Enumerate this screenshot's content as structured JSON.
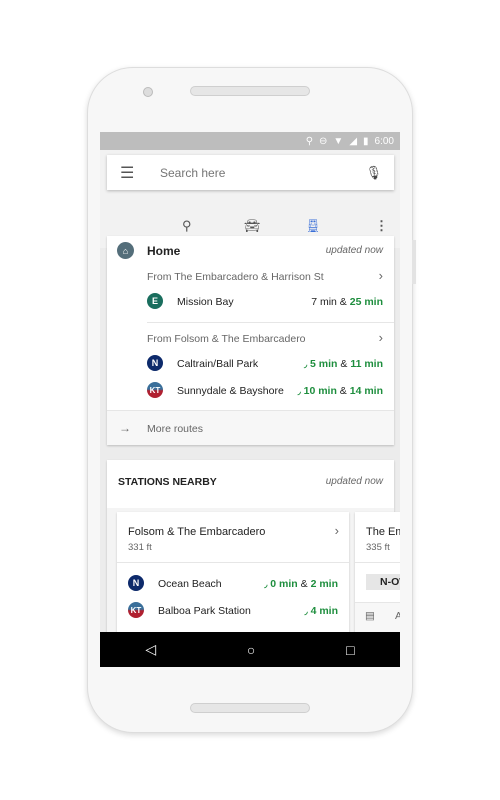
{
  "status_bar": {
    "time": "6:00",
    "icons": [
      "location-icon",
      "dnd-icon",
      "wifi-icon",
      "signal-icon",
      "battery-icon"
    ]
  },
  "search": {
    "placeholder": "Search here"
  },
  "tabs": [
    {
      "icon": "explore-icon"
    },
    {
      "icon": "car-icon"
    },
    {
      "icon": "transit-icon",
      "active": true
    },
    {
      "icon": "more-icon"
    }
  ],
  "home": {
    "title": "Home",
    "updated": "updated now",
    "groups": [
      {
        "from": "From The Embarcadero & Harrison St",
        "routes": [
          {
            "line": "E",
            "color": "#1a6e5e",
            "dest": "Mission Bay",
            "t1": "7 min",
            "t2": "25 min",
            "t1_live": false
          }
        ]
      },
      {
        "from": "From Folsom & The Embarcadero",
        "routes": [
          {
            "line": "N",
            "color": "#0d2a6b",
            "dest": "Caltrain/Ball Park",
            "t1": "5 min",
            "t2": "11 min",
            "t1_live": true
          },
          {
            "line": "KT",
            "color": "#b02030",
            "dest": "Sunnydale & Bayshore",
            "t1": "10 min",
            "t2": "14 min",
            "t1_live": true
          }
        ]
      }
    ],
    "more": "More routes",
    "amp": "&"
  },
  "stations": {
    "title": "STATIONS NEARBY",
    "updated": "updated now",
    "cards": [
      {
        "name": "Folsom & The Embarcadero",
        "dist": "331 ft",
        "routes": [
          {
            "line": "N",
            "color": "#0d2a6b",
            "dest": "Ocean Beach",
            "t1": "0 min",
            "t2": "2 min"
          },
          {
            "line": "KT",
            "color": "#b02030",
            "dest": "Balboa Park Station",
            "t1": "4 min"
          }
        ]
      },
      {
        "name": "The Em",
        "dist": "335 ft",
        "chip": "N-OW",
        "footer": "A"
      }
    ]
  }
}
